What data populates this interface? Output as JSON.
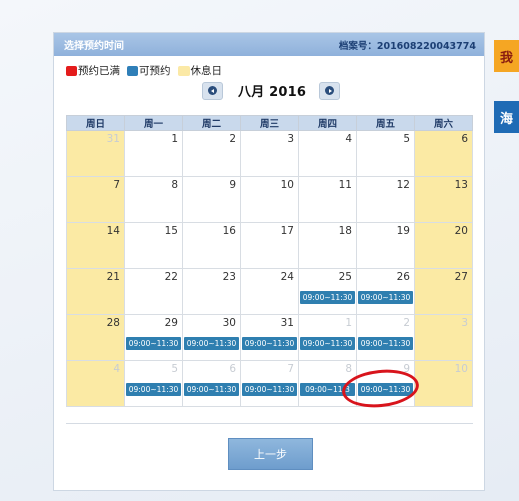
{
  "panel": {
    "title": "选择预约时间",
    "case_number": "档案号：201608220043774"
  },
  "legend": {
    "full": "预约已满",
    "available": "可预约",
    "rest": "休息日"
  },
  "nav": {
    "month_title": "八月 2016"
  },
  "weekdays": [
    "周日",
    "周一",
    "周二",
    "周三",
    "周四",
    "周五",
    "周六"
  ],
  "weeks": [
    [
      {
        "day": "31",
        "type": "weekend",
        "other": true,
        "slot": ""
      },
      {
        "day": "1",
        "type": "normal",
        "other": false,
        "slot": ""
      },
      {
        "day": "2",
        "type": "normal",
        "other": false,
        "slot": ""
      },
      {
        "day": "3",
        "type": "normal",
        "other": false,
        "slot": ""
      },
      {
        "day": "4",
        "type": "normal",
        "other": false,
        "slot": ""
      },
      {
        "day": "5",
        "type": "normal",
        "other": false,
        "slot": ""
      },
      {
        "day": "6",
        "type": "weekend",
        "other": false,
        "slot": ""
      }
    ],
    [
      {
        "day": "7",
        "type": "weekend",
        "other": false,
        "slot": ""
      },
      {
        "day": "8",
        "type": "normal",
        "other": false,
        "slot": ""
      },
      {
        "day": "9",
        "type": "normal",
        "other": false,
        "slot": ""
      },
      {
        "day": "10",
        "type": "normal",
        "other": false,
        "slot": ""
      },
      {
        "day": "11",
        "type": "normal",
        "other": false,
        "slot": ""
      },
      {
        "day": "12",
        "type": "normal",
        "other": false,
        "slot": ""
      },
      {
        "day": "13",
        "type": "weekend",
        "other": false,
        "slot": ""
      }
    ],
    [
      {
        "day": "14",
        "type": "weekend",
        "other": false,
        "slot": ""
      },
      {
        "day": "15",
        "type": "normal",
        "other": false,
        "slot": ""
      },
      {
        "day": "16",
        "type": "normal",
        "other": false,
        "slot": ""
      },
      {
        "day": "17",
        "type": "normal",
        "other": false,
        "slot": ""
      },
      {
        "day": "18",
        "type": "normal",
        "other": false,
        "slot": ""
      },
      {
        "day": "19",
        "type": "normal",
        "other": false,
        "slot": ""
      },
      {
        "day": "20",
        "type": "weekend",
        "other": false,
        "slot": ""
      }
    ],
    [
      {
        "day": "21",
        "type": "weekend",
        "other": false,
        "slot": ""
      },
      {
        "day": "22",
        "type": "normal",
        "other": false,
        "slot": ""
      },
      {
        "day": "23",
        "type": "normal",
        "other": false,
        "slot": ""
      },
      {
        "day": "24",
        "type": "normal",
        "other": false,
        "slot": ""
      },
      {
        "day": "25",
        "type": "normal",
        "other": false,
        "slot": "09:00~11:30"
      },
      {
        "day": "26",
        "type": "normal",
        "other": false,
        "slot": "09:00~11:30"
      },
      {
        "day": "27",
        "type": "weekend",
        "other": false,
        "slot": ""
      }
    ],
    [
      {
        "day": "28",
        "type": "weekend",
        "other": false,
        "slot": ""
      },
      {
        "day": "29",
        "type": "normal",
        "other": false,
        "slot": "09:00~11:30"
      },
      {
        "day": "30",
        "type": "normal",
        "other": false,
        "slot": "09:00~11:30"
      },
      {
        "day": "31",
        "type": "normal",
        "other": false,
        "slot": "09:00~11:30"
      },
      {
        "day": "1",
        "type": "normal",
        "other": true,
        "slot": "09:00~11:30"
      },
      {
        "day": "2",
        "type": "normal",
        "other": true,
        "slot": "09:00~11:30"
      },
      {
        "day": "3",
        "type": "weekend",
        "other": true,
        "slot": ""
      }
    ],
    [
      {
        "day": "4",
        "type": "weekend",
        "other": true,
        "slot": ""
      },
      {
        "day": "5",
        "type": "normal",
        "other": true,
        "slot": "09:00~11:30"
      },
      {
        "day": "6",
        "type": "normal",
        "other": true,
        "slot": "09:00~11:30"
      },
      {
        "day": "7",
        "type": "normal",
        "other": true,
        "slot": "09:00~11:30"
      },
      {
        "day": "8",
        "type": "normal",
        "other": true,
        "slot": "09:00~11:3"
      },
      {
        "day": "9",
        "type": "normal",
        "other": true,
        "slot": "09:00~11:30"
      },
      {
        "day": "10",
        "type": "weekend",
        "other": true,
        "slot": ""
      }
    ]
  ],
  "buttons": {
    "back_label": "上一步"
  },
  "side_tabs": {
    "top_label": "我",
    "bottom_label": "海"
  },
  "colors": {
    "full": "#e41c1c",
    "available": "#2f7fb8",
    "rest": "#fbe9a6",
    "highlight_circle": "#d8141c"
  }
}
